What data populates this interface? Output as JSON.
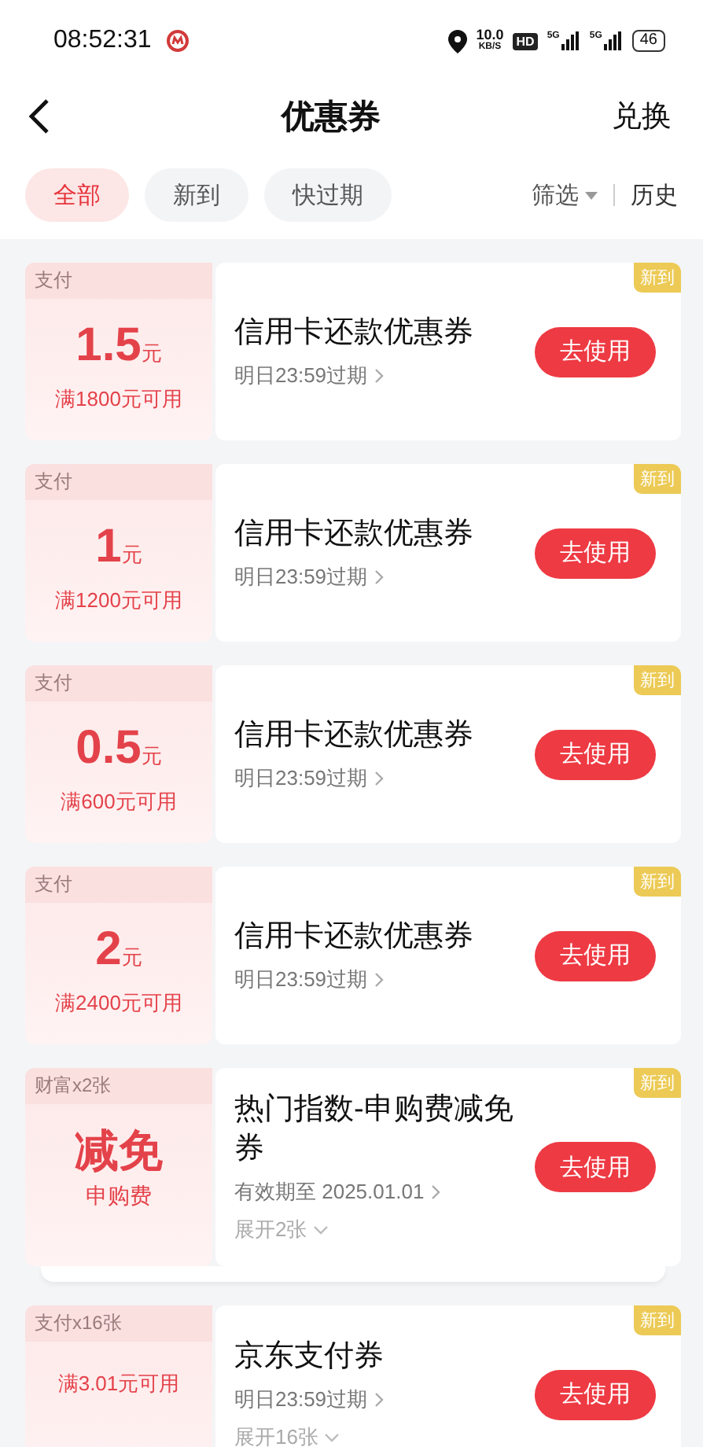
{
  "status_bar": {
    "time": "08:52:31",
    "speed_value": "10.0",
    "speed_unit": "KB/S",
    "hd": "HD",
    "signals": [
      "5G",
      "5G"
    ],
    "battery": "46"
  },
  "header": {
    "title": "优惠券",
    "action": "兑换"
  },
  "filters": {
    "tabs": [
      {
        "label": "全部",
        "selected": true
      },
      {
        "label": "新到",
        "selected": false
      },
      {
        "label": "快过期",
        "selected": false
      }
    ],
    "sort": "筛选",
    "history": "历史"
  },
  "coupons": [
    {
      "kind": "amount",
      "tag": "支付",
      "amount": "1.5",
      "unit": "元",
      "condition": "满1800元可用",
      "title": "信用卡还款优惠券",
      "expiry": "明日23:59过期",
      "badge": "新到",
      "button": "去使用"
    },
    {
      "kind": "amount",
      "tag": "支付",
      "amount": "1",
      "unit": "元",
      "condition": "满1200元可用",
      "title": "信用卡还款优惠券",
      "expiry": "明日23:59过期",
      "badge": "新到",
      "button": "去使用"
    },
    {
      "kind": "amount",
      "tag": "支付",
      "amount": "0.5",
      "unit": "元",
      "condition": "满600元可用",
      "title": "信用卡还款优惠券",
      "expiry": "明日23:59过期",
      "badge": "新到",
      "button": "去使用"
    },
    {
      "kind": "amount",
      "tag": "支付",
      "amount": "2",
      "unit": "元",
      "condition": "满2400元可用",
      "title": "信用卡还款优惠券",
      "expiry": "明日23:59过期",
      "badge": "新到",
      "button": "去使用"
    },
    {
      "kind": "text",
      "tag": "财富x2张",
      "amount": "减免",
      "condition": "申购费",
      "title": "热门指数-申购费减免券",
      "expiry": "有效期至 2025.01.01",
      "expand": "展开2张",
      "stacked": true,
      "badge": "新到",
      "button": "去使用"
    },
    {
      "kind": "amount",
      "tag": "支付x16张",
      "condition": "满3.01元可用",
      "title": "京东支付券",
      "expiry": "明日23:59过期",
      "expand": "展开16张",
      "stacked": false,
      "badge": "新到",
      "button": "去使用"
    }
  ]
}
